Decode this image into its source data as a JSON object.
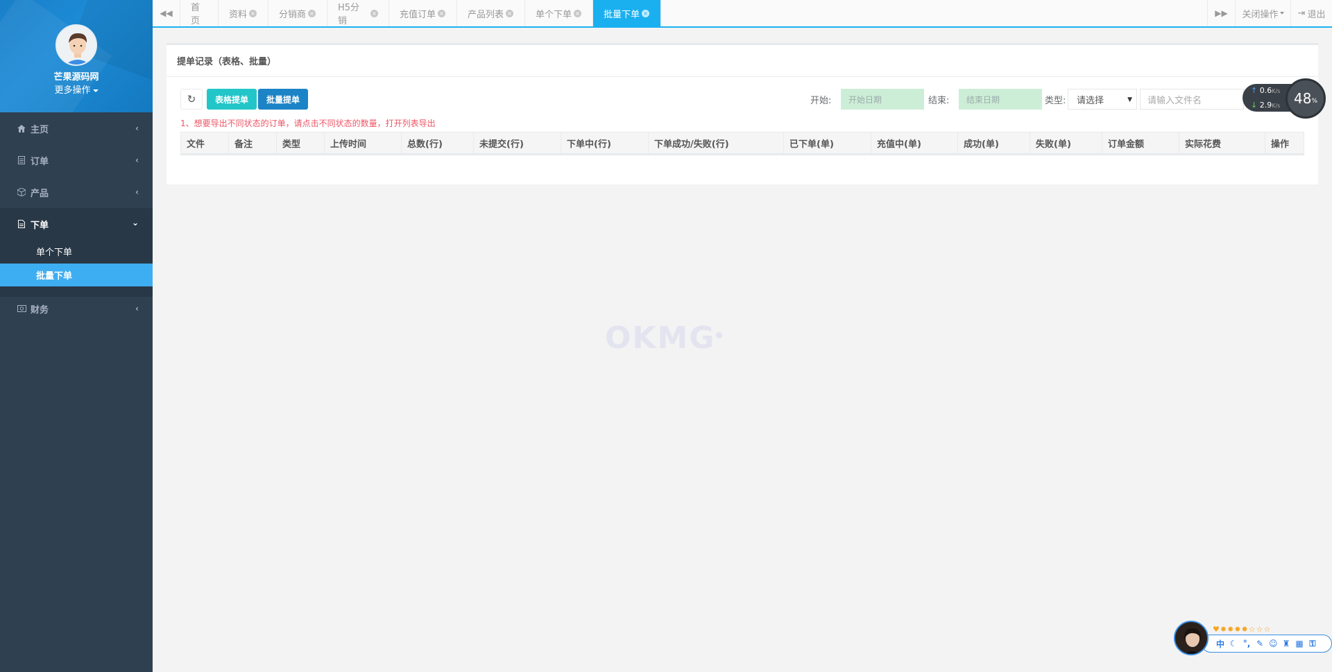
{
  "sidebar": {
    "profile_name": "芒果源码网",
    "more_actions": "更多操作",
    "nav": [
      {
        "label": "主页",
        "icon": "home-icon"
      },
      {
        "label": "订单",
        "icon": "order-icon"
      },
      {
        "label": "产品",
        "icon": "cube-icon"
      },
      {
        "label": "下单",
        "icon": "file-icon"
      },
      {
        "label": "财务",
        "icon": "money-icon"
      }
    ],
    "submenu": [
      {
        "label": "单个下单"
      },
      {
        "label": "批量下单"
      }
    ]
  },
  "tabs": [
    {
      "label": "首页"
    },
    {
      "label": "资料"
    },
    {
      "label": "分销商"
    },
    {
      "label": "H5分销"
    },
    {
      "label": "充值订单"
    },
    {
      "label": "产品列表"
    },
    {
      "label": "单个下单"
    },
    {
      "label": "批量下单"
    }
  ],
  "top_right": {
    "close_ops": "关闭操作",
    "logout": "退出"
  },
  "panel": {
    "title": "提单记录（表格、批量）",
    "btn_table": "表格提单",
    "btn_batch": "批量提单",
    "start_label": "开始:",
    "start_placeholder": "开始日期",
    "end_label": "结束:",
    "end_placeholder": "结束日期",
    "type_label": "类型:",
    "type_selected": "请选择",
    "filename_placeholder": "请输入文件名",
    "hint": "1、想要导出不同状态的订单，请点击不同状态的数量，打开列表导出",
    "columns": [
      "文件",
      "备注",
      "类型",
      "上传时间",
      "总数(行)",
      "未提交(行)",
      "下单中(行)",
      "下单成功/失败(行)",
      "已下单(单)",
      "充值中(单)",
      "成功(单)",
      "失败(单)",
      "订单金额",
      "实际花费",
      "操作"
    ]
  },
  "watermark": "OKMG",
  "speed": {
    "up": "0.6",
    "down": "2.9",
    "unit": "K/s",
    "percent": "48",
    "percent_unit": "%"
  },
  "ime": {
    "label": "中"
  }
}
